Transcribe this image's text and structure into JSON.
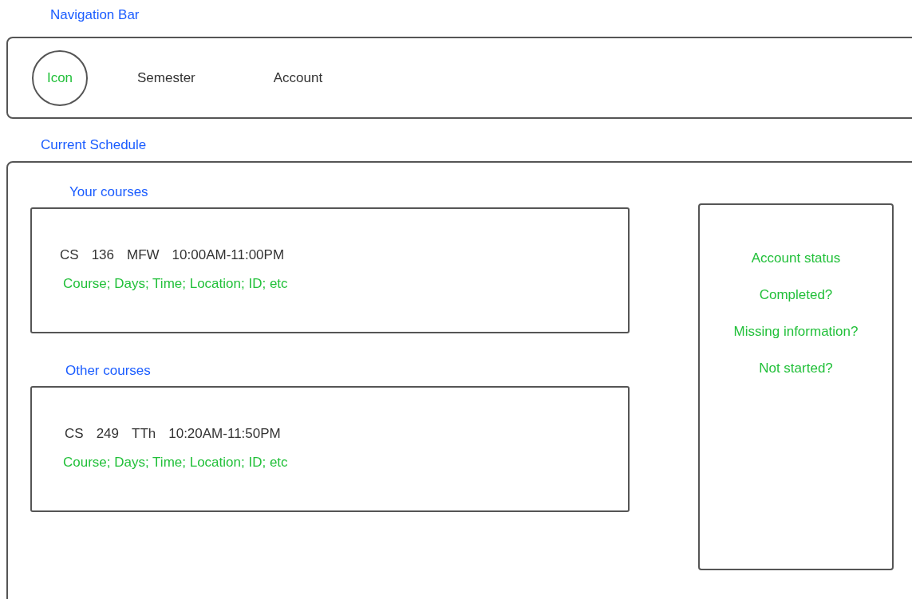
{
  "navigation_bar": {
    "label": "Navigation Bar",
    "icon": "Icon",
    "items": [
      "Semester",
      "Account"
    ]
  },
  "current_schedule": {
    "label": "Current Schedule",
    "sections": [
      {
        "label": "Your courses",
        "course": [
          "CS",
          "136",
          "MFW",
          "10:00AM-11:00PM"
        ],
        "hint": "Course; Days; Time; Location; ID; etc"
      },
      {
        "label": "Other courses",
        "course": [
          "CS",
          "249",
          "TTh",
          "10:20AM-11:50PM"
        ],
        "hint": "Course; Days; Time; Location; ID; etc"
      }
    ],
    "account_panel": [
      "Account status",
      "Completed?",
      "Missing information?",
      "Not started?"
    ]
  }
}
